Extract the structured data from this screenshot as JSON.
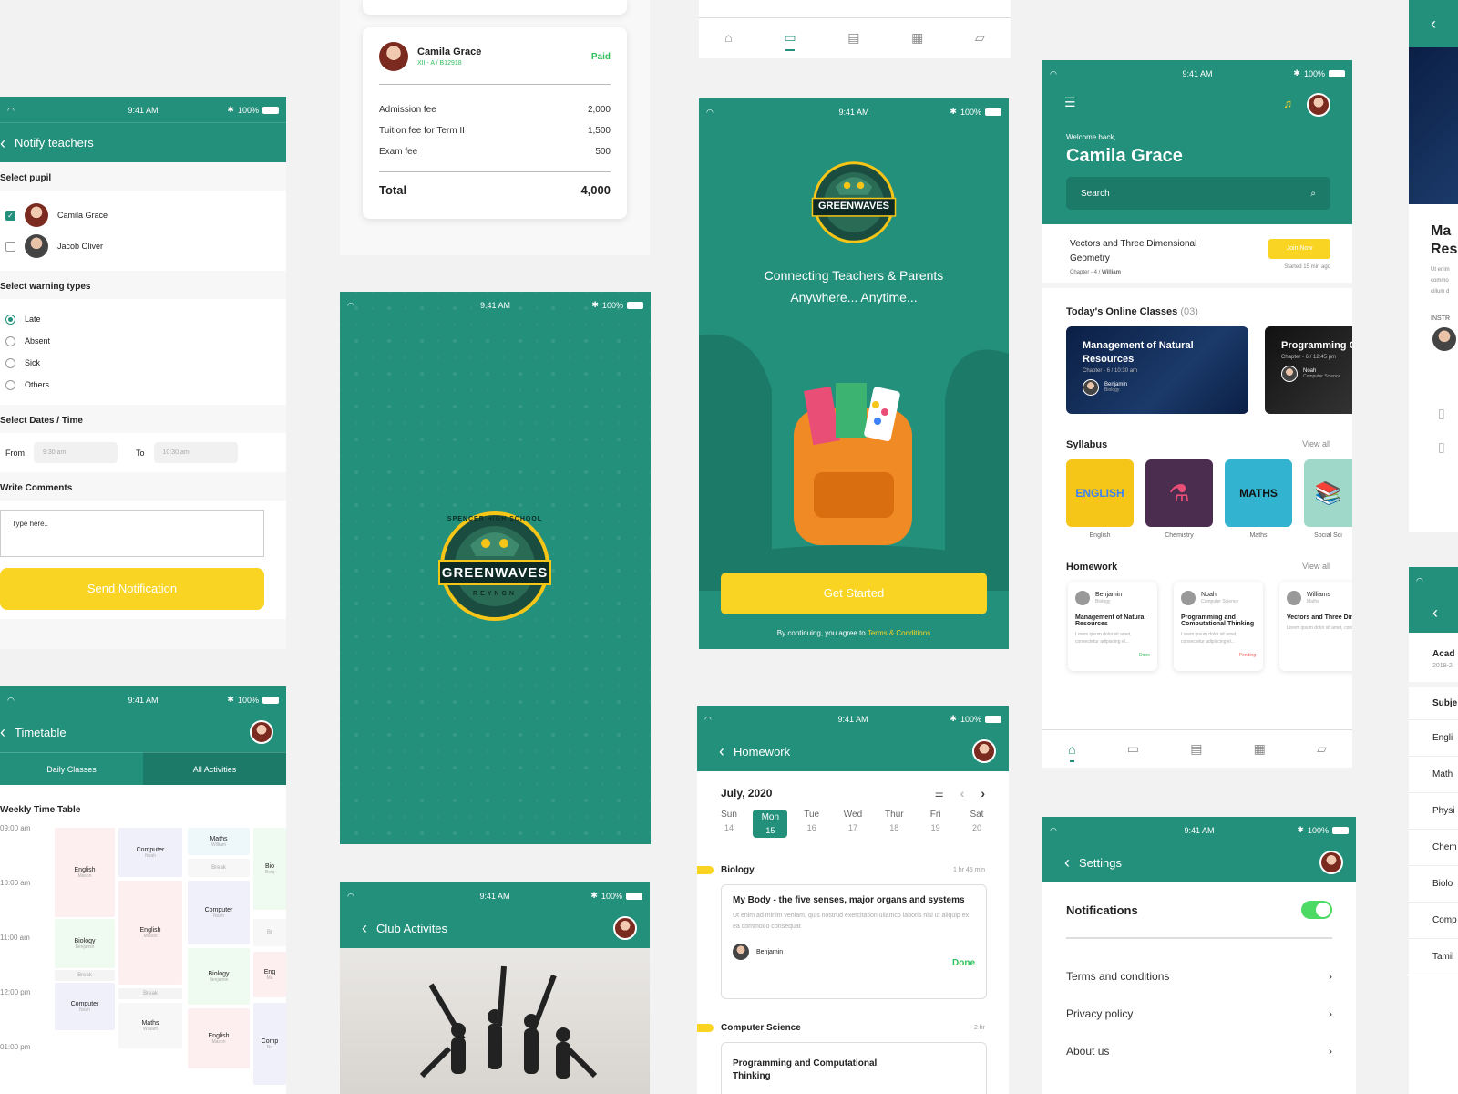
{
  "status": {
    "time": "9:41 AM",
    "battery": "100%"
  },
  "colors": {
    "primary": "#22907b",
    "accent": "#f9d423",
    "paid": "#2fbf5b",
    "pending": "#ff5a5a"
  },
  "notify": {
    "title": "Notify teachers",
    "select_pupil": "Select pupil",
    "pupils": [
      {
        "name": "Camila Grace",
        "checked": true
      },
      {
        "name": "Jacob Oliver",
        "checked": false
      }
    ],
    "warning_title": "Select warning types",
    "warnings": [
      "Late",
      "Absent",
      "Sick",
      "Others"
    ],
    "dates_title": "Select Dates / Time",
    "from_label": "From",
    "from_value": "9:30 am",
    "to_label": "To",
    "to_value": "10:30 am",
    "comments_title": "Write Comments",
    "comments_placeholder": "Type here..",
    "send_button": "Send Notification"
  },
  "timetable": {
    "title": "Timetable",
    "tabs": [
      "Daily Classes",
      "All Activities"
    ],
    "heading": "Weekly Time Table",
    "times": [
      "09:00 am",
      "10:00 am",
      "11:00 am",
      "12:00 pm",
      "01:00 pm"
    ],
    "cells": [
      {
        "subject": "English",
        "teacher": "Mason"
      },
      {
        "subject": "Biology",
        "teacher": "Benjamin"
      },
      {
        "subject": "Break",
        "teacher": ""
      },
      {
        "subject": "Computer",
        "teacher": "Noah"
      },
      {
        "subject": "Computer",
        "teacher": "Noah"
      },
      {
        "subject": "English",
        "teacher": "Mason"
      },
      {
        "subject": "Break",
        "teacher": ""
      },
      {
        "subject": "Maths",
        "teacher": "William"
      },
      {
        "subject": "Maths",
        "teacher": "William"
      },
      {
        "subject": "Break",
        "teacher": ""
      },
      {
        "subject": "Computer",
        "teacher": "Noah"
      },
      {
        "subject": "Biology",
        "teacher": "Benjamin"
      },
      {
        "subject": "English",
        "teacher": "Mason"
      },
      {
        "subject": "Bio",
        "teacher": "Benj"
      },
      {
        "subject": "Br",
        "teacher": ""
      },
      {
        "subject": "Eng",
        "teacher": "Ma"
      },
      {
        "subject": "Comp",
        "teacher": "No"
      }
    ]
  },
  "fees": {
    "student_name": "Camila Grace",
    "student_class": "XII - A / B12918",
    "status": "Paid",
    "items": [
      {
        "label": "Admission fee",
        "amount": "2,000"
      },
      {
        "label": "Tuition fee for Term II",
        "amount": "1,500"
      },
      {
        "label": "Exam fee",
        "amount": "500"
      }
    ],
    "total_label": "Total",
    "total_amount": "4,000"
  },
  "splash": {
    "school_top": "SPENCER HIGH SCHOOL",
    "school_name": "GREENWAVES",
    "school_bottom": "REYNON"
  },
  "club": {
    "title": "Club Activites"
  },
  "onboarding": {
    "tagline_1": "Connecting Teachers & Parents",
    "tagline_2": "Anywhere... Anytime...",
    "button": "Get Started",
    "terms_prefix": "By continuing, you agree to",
    "terms_link": "Terms & Conditions"
  },
  "homework": {
    "title": "Homework",
    "month": "July, 2020",
    "days": [
      {
        "name": "Sun",
        "num": "14"
      },
      {
        "name": "Mon",
        "num": "15"
      },
      {
        "name": "Tue",
        "num": "16"
      },
      {
        "name": "Wed",
        "num": "17"
      },
      {
        "name": "Thur",
        "num": "18"
      },
      {
        "name": "Fri",
        "num": "19"
      },
      {
        "name": "Sat",
        "num": "20"
      }
    ],
    "selected_day": 1,
    "entries": [
      {
        "subject": "Biology",
        "duration": "1 hr 45 min",
        "title": "My Body - the five senses, major organs and systems",
        "desc": "Ut enim ad minim veniam, quis nostrud exercitation ullamco laboris nisi ut aliquip ex ea commodo consequat",
        "teacher": "Benjamin",
        "status": "Done"
      },
      {
        "subject": "Computer Science",
        "duration": "2 hr",
        "title": "Programming and Computational Thinking"
      }
    ]
  },
  "dashboard": {
    "welcome": "Welcome back,",
    "name": "Camila Grace",
    "search_placeholder": "Search",
    "live": {
      "title": "Vectors and Three Dimensional Geometry",
      "chapter": "Chapter - 4 /",
      "teacher": "William",
      "button": "Join Now",
      "started": "Started 15 min ago"
    },
    "online_title": "Today's Online Classes",
    "online_count": "(03)",
    "classes": [
      {
        "title": "Management of Natural Resources",
        "meta": "Chapter - 6 / 10:30 am",
        "teacher": "Benjamin",
        "subject": "Biology"
      },
      {
        "title": "Programming Computation",
        "meta": "Chapter - 6 / 12:45 pm",
        "teacher": "Noah",
        "subject": "Computer Science"
      }
    ],
    "syllabus_title": "Syllabus",
    "view_all": "View all",
    "syllabus": [
      {
        "label": "English",
        "art": "ENGLISH",
        "color": "#f5c518"
      },
      {
        "label": "Chemistry",
        "art": "⚗",
        "color": "#4a2d4f"
      },
      {
        "label": "Maths",
        "art": "MATHS",
        "color": "#32b3cf"
      },
      {
        "label": "Social Sci",
        "art": "📚",
        "color": "#9fd8c8"
      }
    ],
    "homework_title": "Homework",
    "homework": [
      {
        "teacher": "Benjamin",
        "subject": "Biology",
        "title": "Management of Natural Resources",
        "desc": "Lorem ipsum dolor sit amet, consectetur adipiscing el...",
        "status": "Done"
      },
      {
        "teacher": "Noah",
        "subject": "Computer Science",
        "title": "Programming and Computational Thinking",
        "desc": "Lorem ipsum dolor sit amet, consectetur adipiscing el...",
        "status": "Pending"
      },
      {
        "teacher": "Williams",
        "subject": "Maths",
        "title": "Vectors and Three Dimensional Geomet",
        "desc": "Lorem ipsum dolor sit amet, consectetur adipiscing el...",
        "status": ""
      }
    ]
  },
  "settings": {
    "title": "Settings",
    "notifications": "Notifications",
    "notifications_on": true,
    "items": [
      "Terms and conditions",
      "Privacy policy",
      "About us"
    ]
  },
  "edge": {
    "course_title_1": "Ma",
    "course_title_2": "Res",
    "desc": "Ut enim commo cillum d",
    "instructor": "INSTR",
    "year_label": "Acad",
    "year": "2019-2",
    "subject_label": "Subje",
    "subjects": [
      "Engli",
      "Math",
      "Physi",
      "Chem",
      "Biolo",
      "Comp",
      "Tamil"
    ]
  },
  "icons": [
    "home-icon",
    "briefcase-icon",
    "map-icon",
    "table-icon",
    "chat-icon",
    "bell-icon",
    "menu-icon",
    "search-icon",
    "back-icon",
    "list-icon",
    "chevron-left-icon",
    "chevron-right-icon"
  ]
}
